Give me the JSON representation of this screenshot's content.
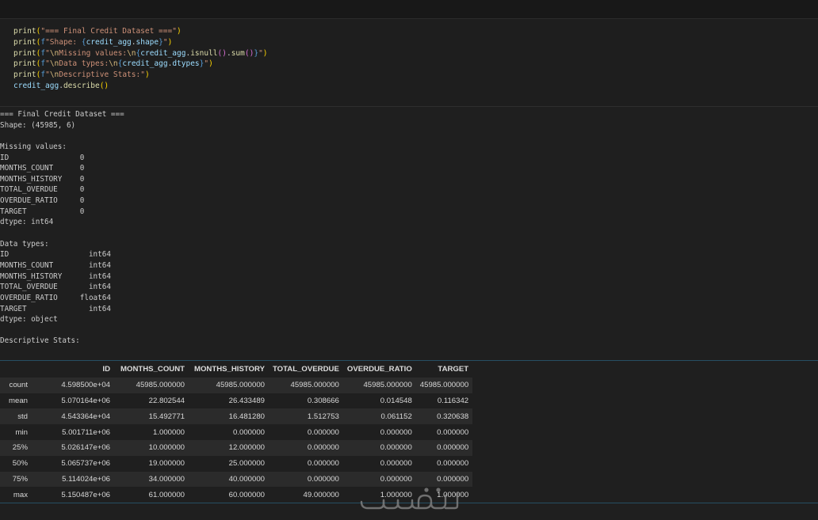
{
  "code": {
    "lines": [
      [
        {
          "t": "print",
          "c": "fn"
        },
        {
          "t": "(",
          "c": "p1"
        },
        {
          "t": "\"=== Final Credit Dataset ===\"",
          "c": "str"
        },
        {
          "t": ")",
          "c": "p1"
        }
      ],
      [
        {
          "t": "print",
          "c": "fn"
        },
        {
          "t": "(",
          "c": "p1"
        },
        {
          "t": "f",
          "c": "fprefix"
        },
        {
          "t": "\"Shape: ",
          "c": "str"
        },
        {
          "t": "{",
          "c": "fprefix"
        },
        {
          "t": "credit_agg",
          "c": "var"
        },
        {
          "t": ".",
          "c": "punct"
        },
        {
          "t": "shape",
          "c": "var"
        },
        {
          "t": "}",
          "c": "fprefix"
        },
        {
          "t": "\"",
          "c": "str"
        },
        {
          "t": ")",
          "c": "p1"
        }
      ],
      [
        {
          "t": "print",
          "c": "fn"
        },
        {
          "t": "(",
          "c": "p1"
        },
        {
          "t": "f",
          "c": "fprefix"
        },
        {
          "t": "\"",
          "c": "str"
        },
        {
          "t": "\\n",
          "c": "esc"
        },
        {
          "t": "Missing values:",
          "c": "str"
        },
        {
          "t": "\\n",
          "c": "esc"
        },
        {
          "t": "{",
          "c": "fprefix"
        },
        {
          "t": "credit_agg",
          "c": "var"
        },
        {
          "t": ".",
          "c": "punct"
        },
        {
          "t": "isnull",
          "c": "fn"
        },
        {
          "t": "()",
          "c": "p2"
        },
        {
          "t": ".",
          "c": "punct"
        },
        {
          "t": "sum",
          "c": "fn"
        },
        {
          "t": "()",
          "c": "p2"
        },
        {
          "t": "}",
          "c": "fprefix"
        },
        {
          "t": "\"",
          "c": "str"
        },
        {
          "t": ")",
          "c": "p1"
        }
      ],
      [
        {
          "t": "print",
          "c": "fn"
        },
        {
          "t": "(",
          "c": "p1"
        },
        {
          "t": "f",
          "c": "fprefix"
        },
        {
          "t": "\"",
          "c": "str"
        },
        {
          "t": "\\n",
          "c": "esc"
        },
        {
          "t": "Data types:",
          "c": "str"
        },
        {
          "t": "\\n",
          "c": "esc"
        },
        {
          "t": "{",
          "c": "fprefix"
        },
        {
          "t": "credit_agg",
          "c": "var"
        },
        {
          "t": ".",
          "c": "punct"
        },
        {
          "t": "dtypes",
          "c": "var"
        },
        {
          "t": "}",
          "c": "fprefix"
        },
        {
          "t": "\"",
          "c": "str"
        },
        {
          "t": ")",
          "c": "p1"
        }
      ],
      [
        {
          "t": "print",
          "c": "fn"
        },
        {
          "t": "(",
          "c": "p1"
        },
        {
          "t": "f",
          "c": "fprefix"
        },
        {
          "t": "\"",
          "c": "str"
        },
        {
          "t": "\\n",
          "c": "esc"
        },
        {
          "t": "Descriptive Stats:\"",
          "c": "str"
        },
        {
          "t": ")",
          "c": "p1"
        }
      ],
      [
        {
          "t": "credit_agg",
          "c": "var"
        },
        {
          "t": ".",
          "c": "punct"
        },
        {
          "t": "describe",
          "c": "fn"
        },
        {
          "t": "()",
          "c": "p1"
        }
      ]
    ]
  },
  "output": {
    "lines": [
      "=== Final Credit Dataset ===",
      "Shape: (45985, 6)",
      "",
      "Missing values:",
      "ID                0",
      "MONTHS_COUNT      0",
      "MONTHS_HISTORY    0",
      "TOTAL_OVERDUE     0",
      "OVERDUE_RATIO     0",
      "TARGET            0",
      "dtype: int64",
      "",
      "Data types:",
      "ID                  int64",
      "MONTHS_COUNT        int64",
      "MONTHS_HISTORY      int64",
      "TOTAL_OVERDUE       int64",
      "OVERDUE_RATIO     float64",
      "TARGET              int64",
      "dtype: object",
      "",
      "Descriptive Stats:"
    ]
  },
  "describe_table": {
    "columns": [
      "",
      "ID",
      "MONTHS_COUNT",
      "MONTHS_HISTORY",
      "TOTAL_OVERDUE",
      "OVERDUE_RATIO",
      "TARGET"
    ],
    "rows": [
      {
        "index": "count",
        "values": [
          "4.598500e+04",
          "45985.000000",
          "45985.000000",
          "45985.000000",
          "45985.000000",
          "45985.000000"
        ]
      },
      {
        "index": "mean",
        "values": [
          "5.070164e+06",
          "22.802544",
          "26.433489",
          "0.308666",
          "0.014548",
          "0.116342"
        ]
      },
      {
        "index": "std",
        "values": [
          "4.543364e+04",
          "15.492771",
          "16.481280",
          "1.512753",
          "0.061152",
          "0.320638"
        ]
      },
      {
        "index": "min",
        "values": [
          "5.001711e+06",
          "1.000000",
          "0.000000",
          "0.000000",
          "0.000000",
          "0.000000"
        ]
      },
      {
        "index": "25%",
        "values": [
          "5.026147e+06",
          "10.000000",
          "12.000000",
          "0.000000",
          "0.000000",
          "0.000000"
        ]
      },
      {
        "index": "50%",
        "values": [
          "5.065737e+06",
          "19.000000",
          "25.000000",
          "0.000000",
          "0.000000",
          "0.000000"
        ]
      },
      {
        "index": "75%",
        "values": [
          "5.114024e+06",
          "34.000000",
          "40.000000",
          "0.000000",
          "0.000000",
          "0.000000"
        ]
      },
      {
        "index": "max",
        "values": [
          "5.150487e+06",
          "61.000000",
          "60.000000",
          "49.000000",
          "1.000000",
          "1.000000"
        ]
      }
    ]
  },
  "watermark": {
    "icon": "khamsat-watermark-logo",
    "color": "#8a8a8a"
  },
  "colors": {
    "background": "#1f1f1f",
    "code_background": "#1e1e1e",
    "output_text": "#cccccc",
    "table_border": "#264f63"
  }
}
